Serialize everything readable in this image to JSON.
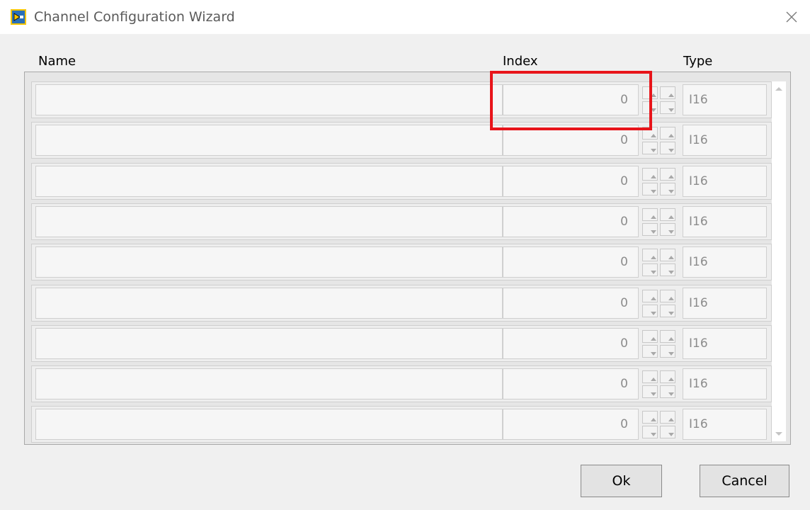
{
  "window": {
    "title": "Channel Configuration Wizard"
  },
  "headers": {
    "name": "Name",
    "index": "Index",
    "type": "Type"
  },
  "rows": [
    {
      "name": "",
      "index": "0",
      "type": "I16"
    },
    {
      "name": "",
      "index": "0",
      "type": "I16"
    },
    {
      "name": "",
      "index": "0",
      "type": "I16"
    },
    {
      "name": "",
      "index": "0",
      "type": "I16"
    },
    {
      "name": "",
      "index": "0",
      "type": "I16"
    },
    {
      "name": "",
      "index": "0",
      "type": "I16"
    },
    {
      "name": "",
      "index": "0",
      "type": "I16"
    },
    {
      "name": "",
      "index": "0",
      "type": "I16"
    },
    {
      "name": "",
      "index": "0",
      "type": "I16"
    }
  ],
  "buttons": {
    "ok": "Ok",
    "cancel": "Cancel"
  },
  "icons": {
    "app": "labview-icon",
    "close": "close-icon"
  },
  "colors": {
    "highlight": "#e8141a"
  }
}
